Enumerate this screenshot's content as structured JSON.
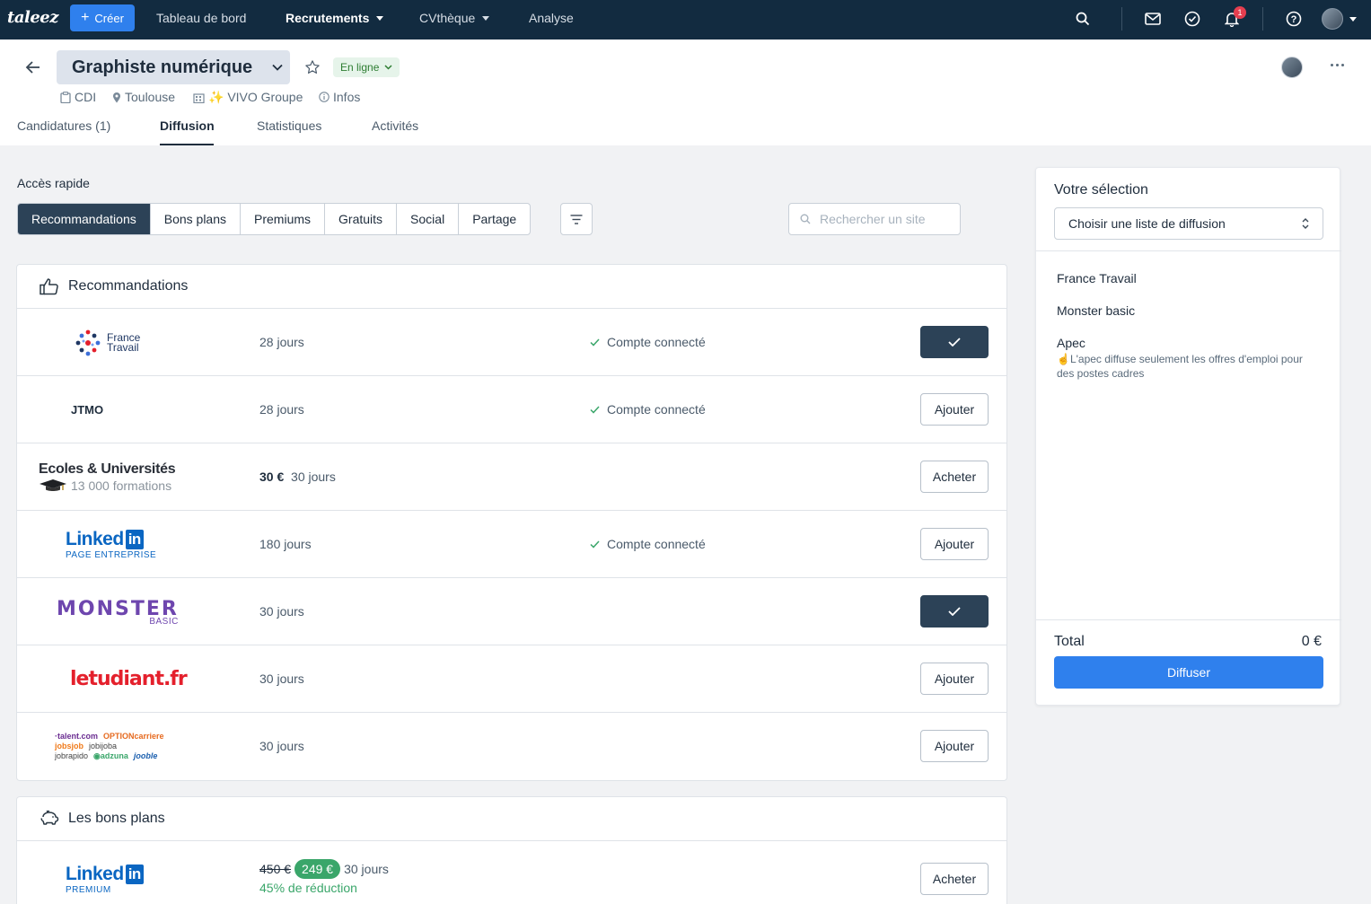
{
  "nav": {
    "logo": "taleez",
    "create": "Créer",
    "items": [
      "Tableau de bord",
      "Recrutements",
      "CVthèque",
      "Analyse"
    ],
    "notification_count": "1"
  },
  "job": {
    "title": "Graphiste numérique",
    "status": "En ligne",
    "contract": "CDI",
    "location": "Toulouse",
    "company": "✨ VIVO Groupe",
    "infos": "Infos"
  },
  "tabs": [
    "Candidatures (1)",
    "Diffusion",
    "Statistiques",
    "Activités"
  ],
  "quick_access": {
    "label": "Accès rapide",
    "segments": [
      "Recommandations",
      "Bons plans",
      "Premiums",
      "Gratuits",
      "Social",
      "Partage"
    ],
    "search_placeholder": "Rechercher un site"
  },
  "recommendations": {
    "title": "Recommandations",
    "rows": [
      {
        "logo": "France Travail",
        "duration": "28 jours",
        "status": "Compte connecté",
        "action": "",
        "checked": true
      },
      {
        "logo": "JTMO",
        "duration": "28 jours",
        "status": "Compte connecté",
        "action": "Ajouter",
        "checked": false
      },
      {
        "logo": "Ecoles & Universités",
        "logo_sub": "13 000 formations",
        "price": "30 €",
        "duration": "30 jours",
        "status": "",
        "action": "Acheter",
        "checked": false
      },
      {
        "logo": "Linked",
        "logo_sub": "PAGE ENTREPRISE",
        "duration": "180 jours",
        "status": "Compte connecté",
        "action": "Ajouter",
        "checked": false
      },
      {
        "logo": "MONSTER",
        "logo_sub": "BASIC",
        "duration": "30 jours",
        "status": "",
        "action": "",
        "checked": true
      },
      {
        "logo": "letudiant.fr",
        "duration": "30 jours",
        "status": "",
        "action": "Ajouter",
        "checked": false
      },
      {
        "logo": "talent.com optioncarriere jobijoba jobrapido adzuna jooble",
        "duration": "30 jours",
        "status": "",
        "action": "Ajouter",
        "checked": false
      }
    ]
  },
  "bons_plans": {
    "title": "Les bons plans",
    "rows": [
      {
        "logo": "Linked",
        "logo_sub": "PREMIUM",
        "old_price": "450 €",
        "price": "249 €",
        "duration": "30 jours",
        "discount": "45% de réduction",
        "action": "Acheter"
      }
    ]
  },
  "selection": {
    "title": "Votre sélection",
    "select_value": "Choisir une liste de diffusion",
    "items": [
      "France Travail",
      "Monster basic",
      "Apec"
    ],
    "apec_note": "☝️L'apec diffuse seulement les offres d'emploi pour des postes cadres",
    "total_label": "Total",
    "total_value": "0 €",
    "submit": "Diffuser"
  },
  "colors": {
    "nav_bg": "#122b40",
    "primary": "#2f80ed",
    "dark_button": "#2c4257",
    "success": "#3aa66a"
  }
}
